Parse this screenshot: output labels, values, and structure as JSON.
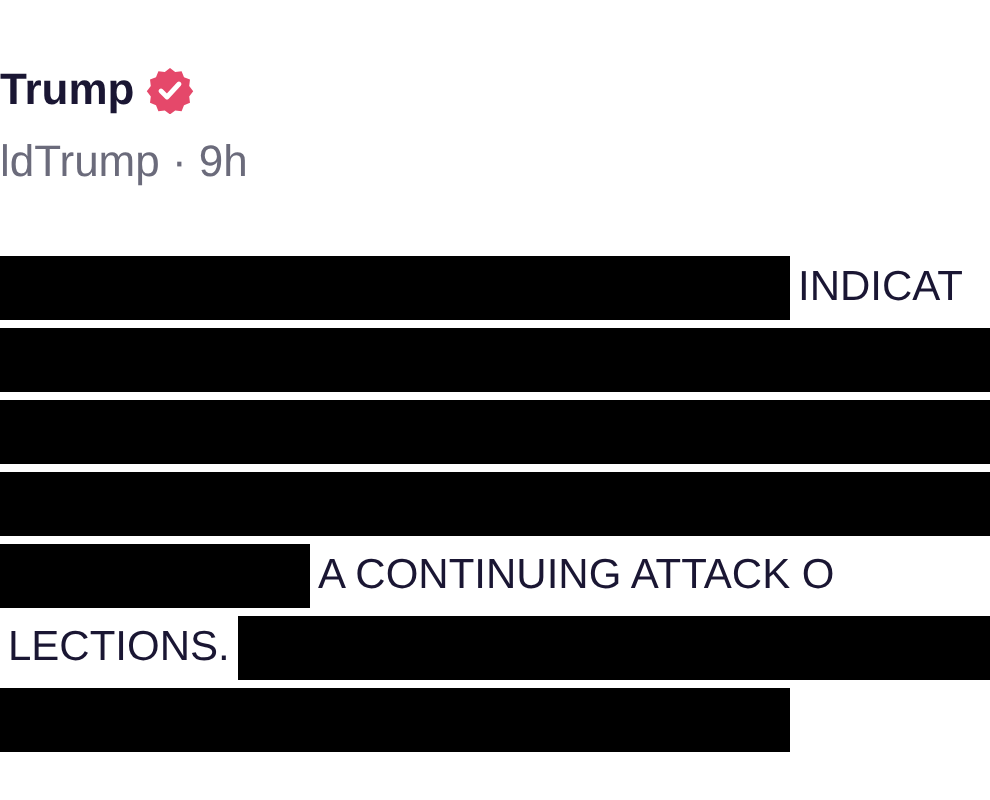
{
  "author": {
    "name": "Trump",
    "verified": true,
    "handle": "ldTrump · 9h"
  },
  "lines": [
    [
      {
        "kind": "redacted"
      },
      {
        "kind": "text",
        "text": "INDICAT"
      }
    ],
    [
      {
        "kind": "redacted"
      }
    ],
    [
      {
        "kind": "redacted"
      }
    ],
    [
      {
        "kind": "redacted"
      }
    ],
    [
      {
        "kind": "redacted"
      },
      {
        "kind": "text",
        "text": "A CONTINUING ATTACK O"
      }
    ],
    [
      {
        "kind": "text",
        "text": "LECTIONS."
      },
      {
        "kind": "redacted"
      }
    ],
    [
      {
        "kind": "redacted"
      }
    ]
  ]
}
